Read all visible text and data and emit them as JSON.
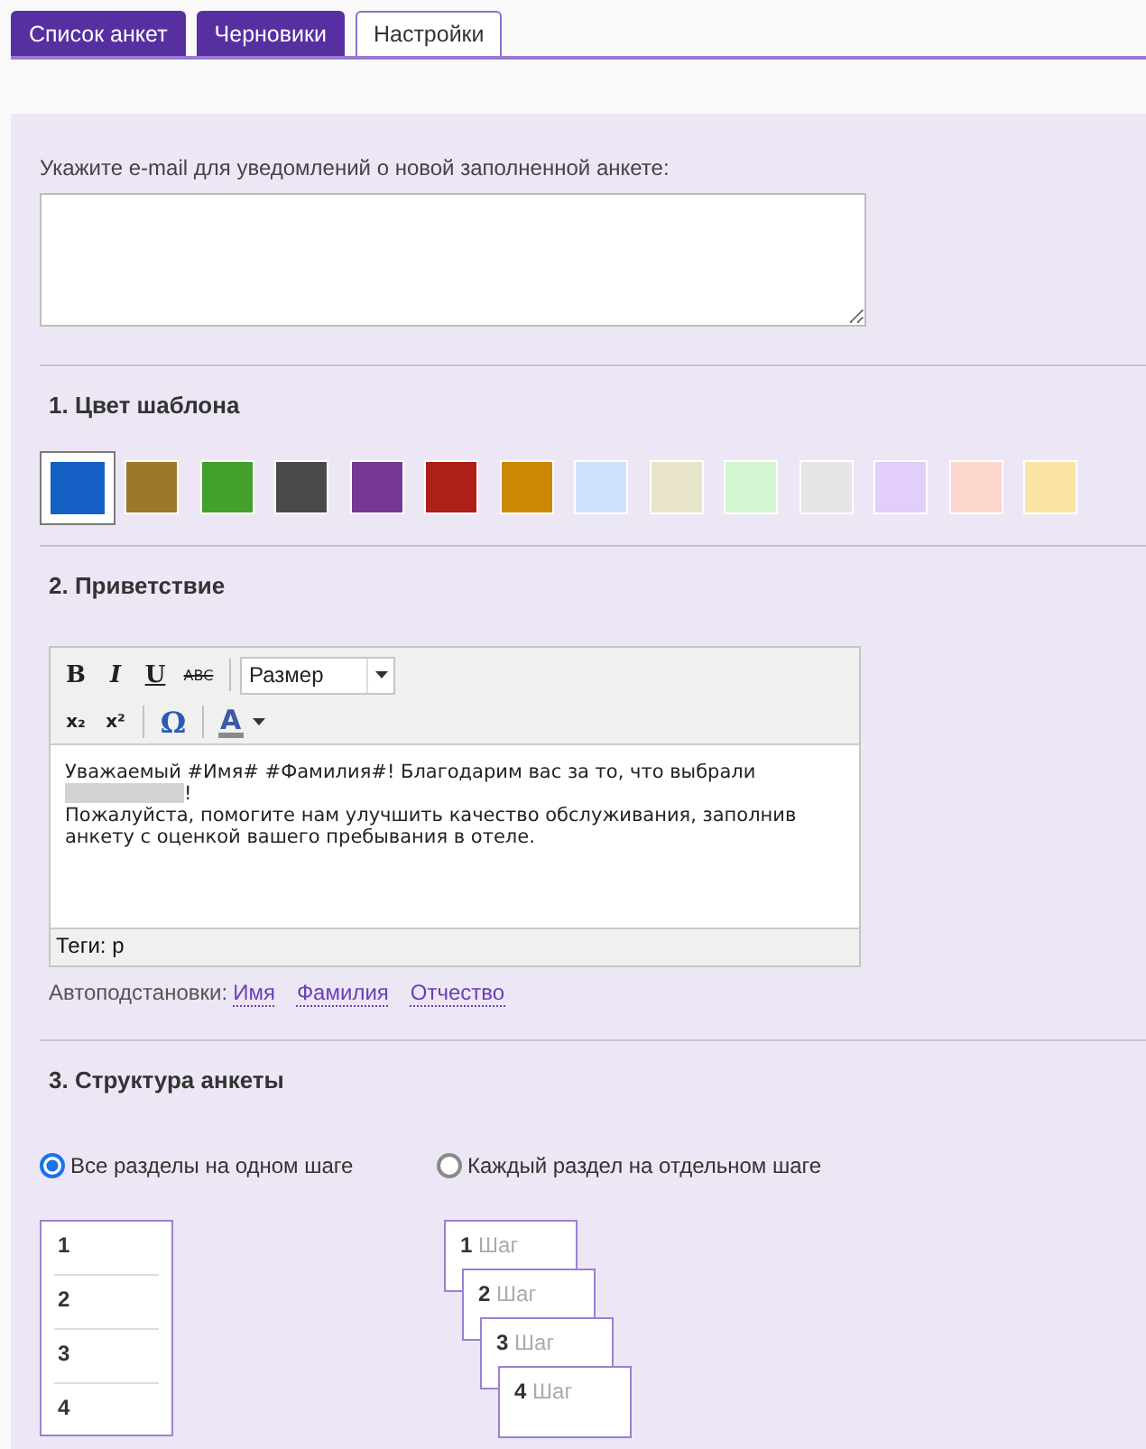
{
  "tabs": [
    {
      "label": "Список анкет",
      "selected": false
    },
    {
      "label": "Черновики",
      "selected": false
    },
    {
      "label": "Настройки",
      "selected": true
    }
  ],
  "email": {
    "label": "Укажите e-mail для уведомлений о новой заполненной анкете:"
  },
  "template_color": {
    "title": "1. Цвет шаблона",
    "swatches": [
      {
        "color": "#1560c4",
        "selected": true
      },
      {
        "color": "#9c782a",
        "selected": false
      },
      {
        "color": "#42a12a",
        "selected": false
      },
      {
        "color": "#4a4a4a",
        "selected": false
      },
      {
        "color": "#763893",
        "selected": false
      },
      {
        "color": "#ad1f17",
        "selected": false
      },
      {
        "color": "#cc8800",
        "selected": false
      },
      {
        "color": "#cfe2fb",
        "selected": false
      },
      {
        "color": "#e8e5cb",
        "selected": false
      },
      {
        "color": "#d3f5cf",
        "selected": false
      },
      {
        "color": "#e6e6e6",
        "selected": false
      },
      {
        "color": "#e1cefa",
        "selected": false
      },
      {
        "color": "#fdd6cd",
        "selected": false
      },
      {
        "color": "#fbe3a3",
        "selected": false
      }
    ]
  },
  "greeting": {
    "title": "2. Приветствие",
    "toolbar": [
      [
        {
          "kind": "bold",
          "label": "B"
        },
        {
          "kind": "italic",
          "label": "I"
        },
        {
          "kind": "underline",
          "label": "U"
        },
        {
          "kind": "strike",
          "label": "ABC"
        },
        {
          "kind": "separator"
        },
        {
          "kind": "select",
          "label": "Размер"
        }
      ],
      [
        {
          "kind": "subscript",
          "label": "x₂"
        },
        {
          "kind": "superscript",
          "label": "x²"
        },
        {
          "kind": "separator"
        },
        {
          "kind": "symbol",
          "label": "Ω"
        },
        {
          "kind": "separator"
        },
        {
          "kind": "color",
          "label": "A"
        }
      ]
    ],
    "body": [
      {
        "kind": "text",
        "text": "Уважаемый #Имя# #Фамилия#! Благодарим вас за то, что выбрали"
      },
      {
        "kind": "redacted"
      },
      {
        "kind": "text",
        "text": "!"
      },
      {
        "kind": "break"
      },
      {
        "kind": "text",
        "text": "Пожалуйста, помогите нам улучшить качество обслуживания, заполнив анкету с оценкой вашего пребывания в отеле."
      }
    ],
    "status": "Теги: p",
    "autosubst_label": "Автоподстановки:",
    "autosubst_links": [
      "Имя",
      "Фамилия",
      "Отчество"
    ]
  },
  "structure": {
    "title": "3. Структура анкеты",
    "options": [
      {
        "label": "Все разделы на одном шаге",
        "selected": true
      },
      {
        "label": "Каждый раздел на отдельном шаге",
        "selected": false
      }
    ],
    "single_preview": [
      "1",
      "2",
      "3",
      "4"
    ],
    "steps_preview": [
      {
        "number": "1",
        "label": "Шаг"
      },
      {
        "number": "2",
        "label": "Шаг"
      },
      {
        "number": "3",
        "label": "Шаг"
      },
      {
        "number": "4",
        "label": "Шаг"
      }
    ]
  }
}
